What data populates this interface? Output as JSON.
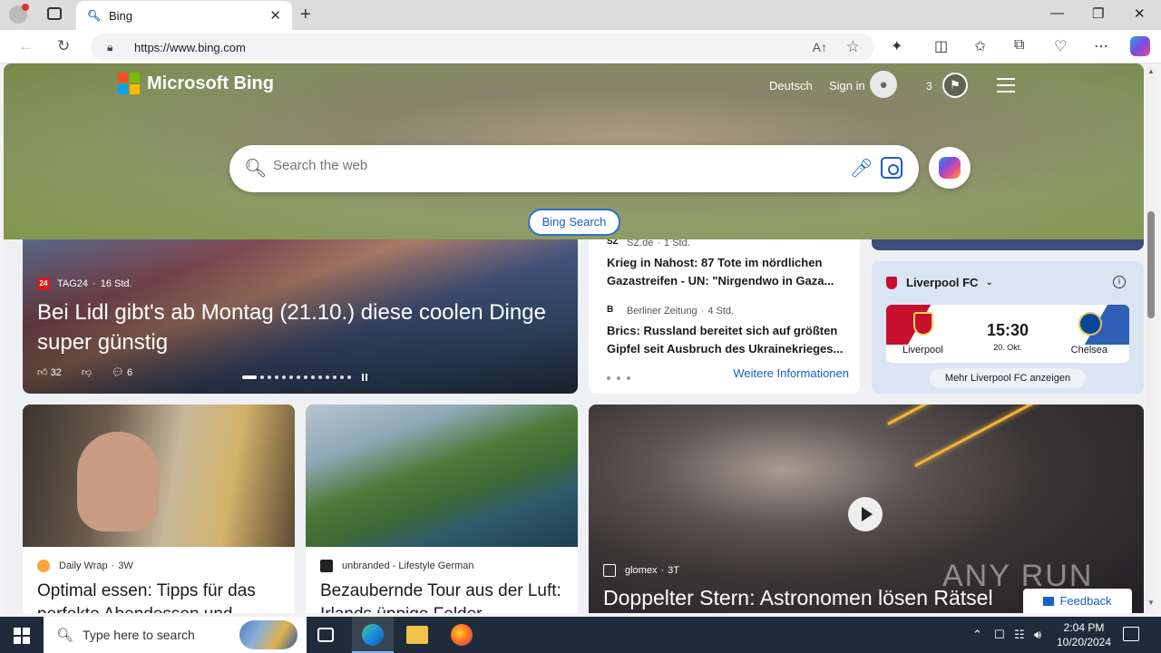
{
  "browser": {
    "tab_title": "Bing",
    "url": "https://www.bing.com"
  },
  "header": {
    "logo_text": "Microsoft Bing",
    "language": "Deutsch",
    "sign_in": "Sign in",
    "rewards_count": "3"
  },
  "search": {
    "placeholder": "Search the web",
    "button": "Bing Search"
  },
  "feature_story": {
    "source": "TAG24",
    "source_badge": "24",
    "age": "16 Std.",
    "headline": "Bei Lidl gibt's ab Montag (21.10.) diese coolen Dinge super günstig",
    "likes": "32",
    "comments": "6"
  },
  "news_list": {
    "items": [
      {
        "source": "SZ.de",
        "age": "1 Std.",
        "headline": "Krieg in Nahost: 87 Tote im nördlichen Gazastreifen - UN: \"Nirgendwo in Gaza..."
      },
      {
        "source": "Berliner Zeitung",
        "age": "4 Std.",
        "headline": "Brics: Russland bereitet sich auf größten Gipfel seit Ausbruch des Ukrainekrieges..."
      }
    ],
    "more": "Weitere Informationen"
  },
  "sports": {
    "team": "Liverpool FC",
    "home": "Liverpool",
    "away": "Chelsea",
    "time": "15:30",
    "date": "20. Okt.",
    "more": "Mehr Liverpool FC anzeigen"
  },
  "cards": [
    {
      "source": "Daily Wrap",
      "age": "3W",
      "headline": "Optimal essen: Tipps für das perfekte Abendessen und"
    },
    {
      "source": "unbranded - Lifestyle German",
      "headline": "Bezaubernde Tour aus der Luft: Irlands üppige Felder"
    },
    {
      "source": "glomex",
      "age": "3T",
      "headline": "Doppelter Stern: Astronomen lösen Rätsel"
    }
  ],
  "feedback": "Feedback",
  "watermark": "ANY RUN",
  "taskbar": {
    "search_placeholder": "Type here to search",
    "time": "2:04 PM",
    "date": "10/20/2024"
  }
}
